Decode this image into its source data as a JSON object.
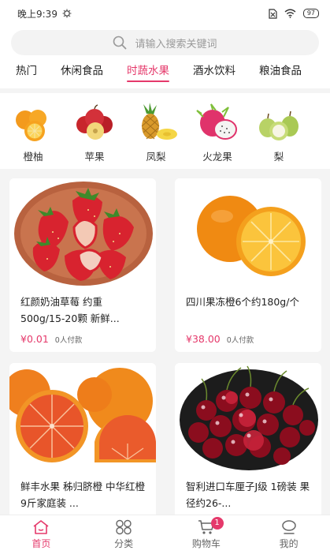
{
  "status_bar": {
    "time": "晚上9:39",
    "battery": "97"
  },
  "search": {
    "placeholder": "请输入搜索关键词"
  },
  "tabs": [
    {
      "label": "热门"
    },
    {
      "label": "休闲食品"
    },
    {
      "label": "时蔬水果"
    },
    {
      "label": "酒水饮料"
    },
    {
      "label": "粮油食品"
    }
  ],
  "active_tab": "时蔬水果",
  "categories": [
    {
      "label": "橙柚",
      "icon": "oranges"
    },
    {
      "label": "苹果",
      "icon": "apples"
    },
    {
      "label": "凤梨",
      "icon": "pineapple"
    },
    {
      "label": "火龙果",
      "icon": "dragon-fruit"
    },
    {
      "label": "梨",
      "icon": "pears"
    }
  ],
  "products": [
    {
      "name": "红颜奶油草莓 约重500g/15-20颗 新鲜...",
      "price": "¥0.01",
      "sold": "0人付款",
      "image": "strawberries"
    },
    {
      "name": "四川果冻橙6个约180g/个",
      "price": "¥38.00",
      "sold": "0人付款",
      "image": "oranges"
    },
    {
      "name": "鲜丰水果 秭归脐橙 中华红橙 9斤家庭装 ...",
      "price": "",
      "sold": "",
      "image": "blood-oranges"
    },
    {
      "name": "智利进口车厘子J级 1磅装 果径约26-...",
      "price": "",
      "sold": "",
      "image": "cherries"
    }
  ],
  "bottom_nav": [
    {
      "label": "首页",
      "icon": "home-icon"
    },
    {
      "label": "分类",
      "icon": "category-icon"
    },
    {
      "label": "购物车",
      "icon": "cart-icon",
      "badge": "1"
    },
    {
      "label": "我的",
      "icon": "profile-icon"
    }
  ],
  "colors": {
    "accent": "#e5396b",
    "background": "#f4f4f4"
  }
}
